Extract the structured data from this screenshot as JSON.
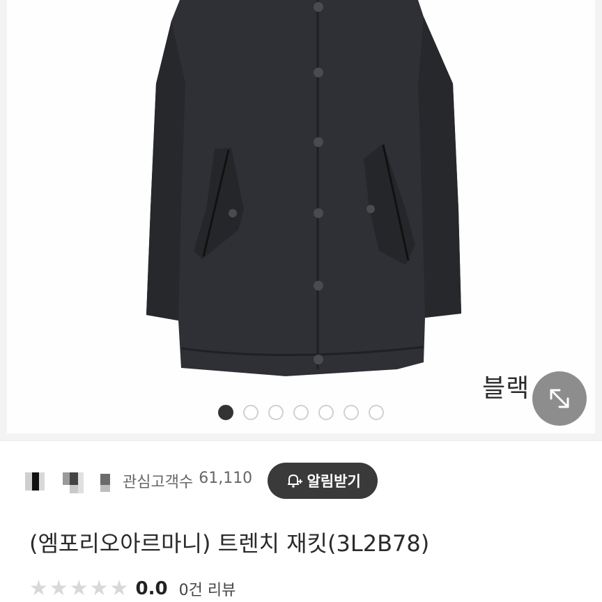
{
  "gallery": {
    "color_label": "블랙",
    "total_images": 7,
    "current_index": 1
  },
  "seller": {
    "watchers_label": "관심고객수",
    "watchers_count": "61,110",
    "alarm_label": "알림받기"
  },
  "product": {
    "title": "(엠포리오아르마니) 트렌치 재킷(3L2B78)"
  },
  "rating": {
    "score": "0.0",
    "reviews": "0건 리뷰",
    "stars_filled": 0,
    "stars_total": 5
  },
  "colors": {
    "coat": "#2e3035",
    "button_dark": "#3a3a3a",
    "zoom_bg": "#8d8d8d"
  },
  "icons": {
    "zoom": "expand-arrows-icon",
    "alarm": "bell-plus-icon"
  }
}
